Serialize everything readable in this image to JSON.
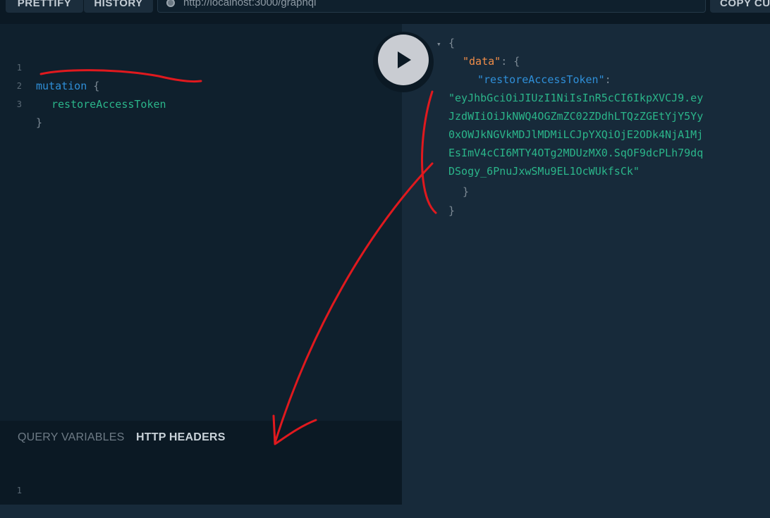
{
  "toolbar": {
    "prettify_label": "PRETTIFY",
    "history_label": "HISTORY",
    "endpoint_url": "http://localhost:3000/graphql",
    "copy_label": "COPY CU"
  },
  "query_editor": {
    "lines": [
      {
        "number": "1",
        "keyword": "mutation",
        "punct": "{"
      },
      {
        "number": "2",
        "field": "restoreAccessToken"
      },
      {
        "number": "3",
        "punct": "}"
      }
    ]
  },
  "variables_panel": {
    "tab_query_variables": "QUERY VARIABLES",
    "tab_http_headers": "HTTP HEADERS",
    "line_number": "1"
  },
  "result": {
    "fold_marker": "▾",
    "open_brace": "{",
    "data_key": "\"data\"",
    "colon_open": ": {",
    "token_key": "\"restoreAccessToken\"",
    "colon": ":",
    "token_lines": [
      "\"eyJhbGciOiJIUzI1NiIsInR5cCI6IkpXVCJ9.ey",
      "JzdWIiOiJkNWQ4OGZmZC02ZDdhLTQzZGEtYjY5Yy",
      "0xOWJkNGVkMDJlMDMiLCJpYXQiOjE2ODk4NjA1Mj",
      "EsImV4cCI6MTY4OTg2MDUzMX0.SqOF9dcPLh79dq",
      "DSogy_6PnuJxwSMu9EL1OcWUkfsCk\""
    ],
    "inner_close": "}",
    "outer_close": "}"
  },
  "colors": {
    "annotation_red": "#e0191e",
    "keyword_blue": "#2f8fd8",
    "string_green": "#2bb58a",
    "data_key_orange": "#f08d49"
  },
  "icons": {
    "play": "play-icon",
    "status": "status-dot-icon"
  }
}
